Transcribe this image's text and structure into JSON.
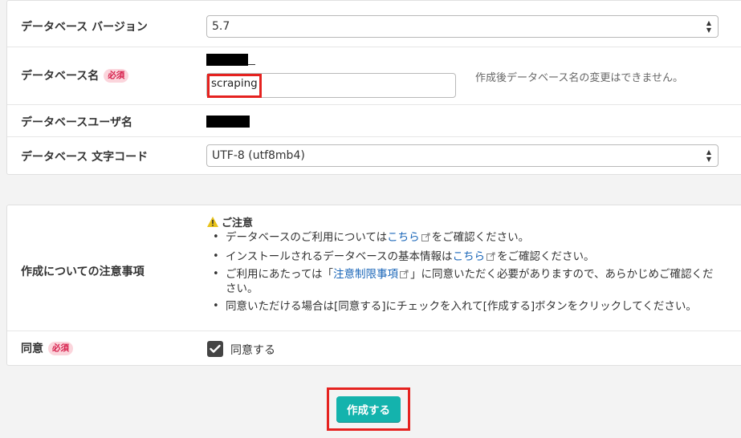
{
  "db_settings": {
    "version": {
      "label": "データベース バージョン",
      "value": "5.7"
    },
    "db_name": {
      "label": "データベース名",
      "required_badge": "必須",
      "input_value": "scraping",
      "helper_text": "作成後データベース名の変更はできません。"
    },
    "db_user": {
      "label": "データベースユーザ名"
    },
    "charset": {
      "label": "データベース 文字コード",
      "value": "UTF-8 (utf8mb4)"
    }
  },
  "notice": {
    "label": "作成についての注意事項",
    "title": "ご注意",
    "items": {
      "item1": {
        "before": "データベースのご利用については",
        "link": "こちら",
        "after": "をご確認ください。"
      },
      "item2": {
        "before": "インストールされるデータベースの基本情報は",
        "link": "こちら",
        "after": "をご確認ください。"
      },
      "item3": {
        "before": "ご利用にあたっては「",
        "link": "注意制限事項",
        "after": "」に同意いただく必要がありますので、あらかじめご確認ください。"
      },
      "item4": {
        "text": "同意いただける場合は[同意する]にチェックを入れて[作成する]ボタンをクリックしてください。"
      }
    }
  },
  "agree": {
    "label": "同意",
    "required_badge": "必須",
    "checkbox_label": "同意する",
    "checked": true
  },
  "submit": {
    "label": "作成する"
  },
  "colors": {
    "accent": "#14b3ad",
    "required": "#d6204c",
    "highlight": "#e5221f",
    "link": "#1a66b8"
  }
}
